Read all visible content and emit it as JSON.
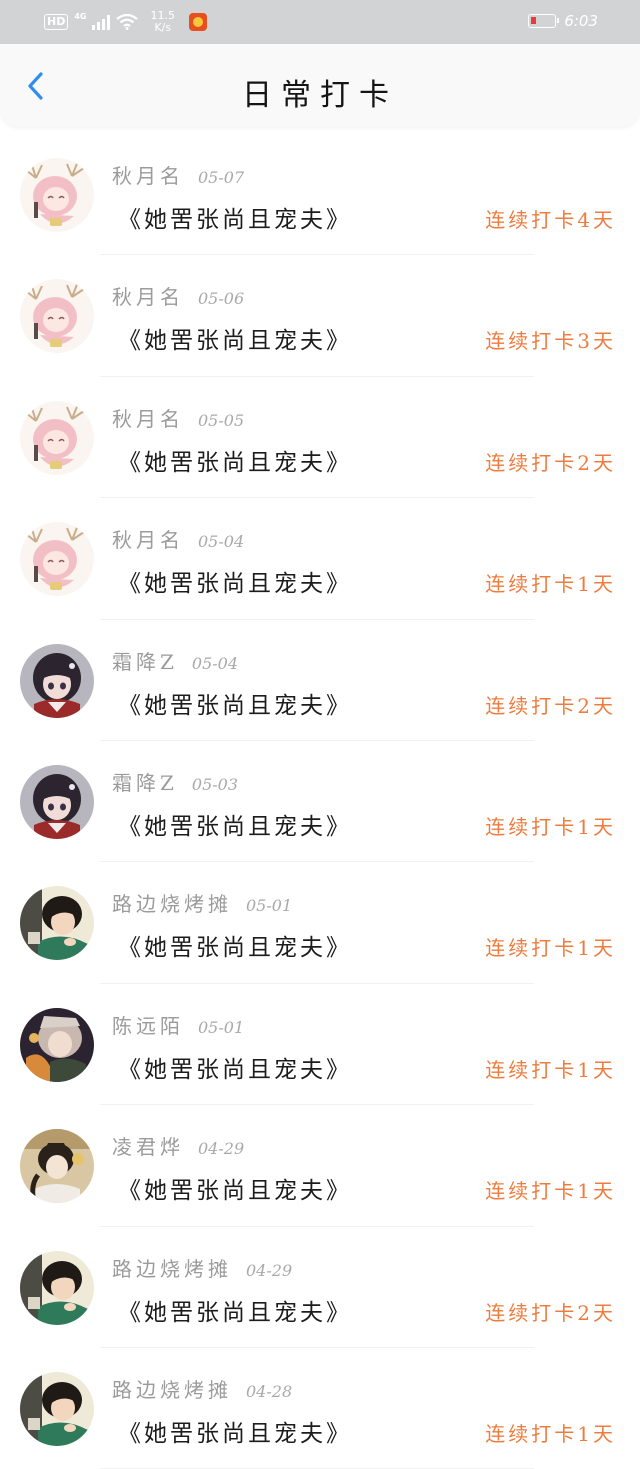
{
  "status_bar": {
    "hd": "HD",
    "network": "4G",
    "speed": "11.5",
    "speed_unit": "K/s",
    "time": "6:03"
  },
  "header": {
    "title": "日常打卡"
  },
  "colors": {
    "accent": "#ed7c3e",
    "back": "#2f8eed"
  },
  "entries": [
    {
      "user": "秋月名",
      "date": "05-07",
      "book": "《她罟张尚且宠夫》",
      "streak": "连续打卡4天",
      "avatar": "pink-horned-anime-avatar"
    },
    {
      "user": "秋月名",
      "date": "05-06",
      "book": "《她罟张尚且宠夫》",
      "streak": "连续打卡3天",
      "avatar": "pink-horned-anime-avatar"
    },
    {
      "user": "秋月名",
      "date": "05-05",
      "book": "《她罟张尚且宠夫》",
      "streak": "连续打卡2天",
      "avatar": "pink-horned-anime-avatar"
    },
    {
      "user": "秋月名",
      "date": "05-04",
      "book": "《她罟张尚且宠夫》",
      "streak": "连续打卡1天",
      "avatar": "pink-horned-anime-avatar"
    },
    {
      "user": "霜降Z",
      "date": "05-04",
      "book": "《她罟张尚且宠夫》",
      "streak": "连续打卡2天",
      "avatar": "dark-hair-anime-girl-avatar"
    },
    {
      "user": "霜降Z",
      "date": "05-03",
      "book": "《她罟张尚且宠夫》",
      "streak": "连续打卡1天",
      "avatar": "dark-hair-anime-girl-avatar"
    },
    {
      "user": "路边烧烤摊",
      "date": "05-01",
      "book": "《她罟张尚且宠夫》",
      "streak": "连续打卡1天",
      "avatar": "green-robe-boy-avatar"
    },
    {
      "user": "陈远陌",
      "date": "05-01",
      "book": "《她罟张尚且宠夫》",
      "streak": "连续打卡1天",
      "avatar": "dark-painted-avatar"
    },
    {
      "user": "凌君烨",
      "date": "04-29",
      "book": "《她罟张尚且宠夫》",
      "streak": "连续打卡1天",
      "avatar": "golden-ancient-avatar"
    },
    {
      "user": "路边烧烤摊",
      "date": "04-29",
      "book": "《她罟张尚且宠夫》",
      "streak": "连续打卡2天",
      "avatar": "green-robe-boy-avatar"
    },
    {
      "user": "路边烧烤摊",
      "date": "04-28",
      "book": "《她罟张尚且宠夫》",
      "streak": "连续打卡1天",
      "avatar": "green-robe-boy-avatar"
    }
  ]
}
